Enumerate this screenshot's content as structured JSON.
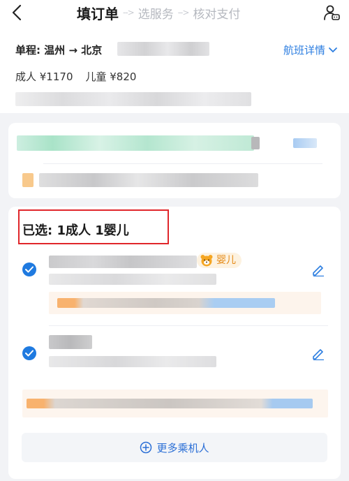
{
  "header": {
    "steps": [
      "填订单",
      "选服务",
      "核对支付"
    ],
    "arrow": "-->"
  },
  "flight": {
    "route": "单程: 温州 → 北京",
    "detail_link": "航班详情",
    "adult_price": "成人 ¥1170",
    "child_price": "儿童 ¥820"
  },
  "passengers": {
    "selected_title": "已选: 1成人  1婴儿",
    "infant_badge": "婴儿",
    "more_button": "更多乘机人"
  },
  "colors": {
    "accent": "#1f7ae0",
    "link": "#2b7de0",
    "highlight_border": "#e0262b",
    "badge_text": "#e58a16"
  },
  "icons": [
    "back-arrow-icon",
    "customer-service-icon",
    "chevron-down-icon",
    "checkmark-icon",
    "edit-pencil-icon",
    "bear-icon",
    "plus-circle-icon"
  ]
}
